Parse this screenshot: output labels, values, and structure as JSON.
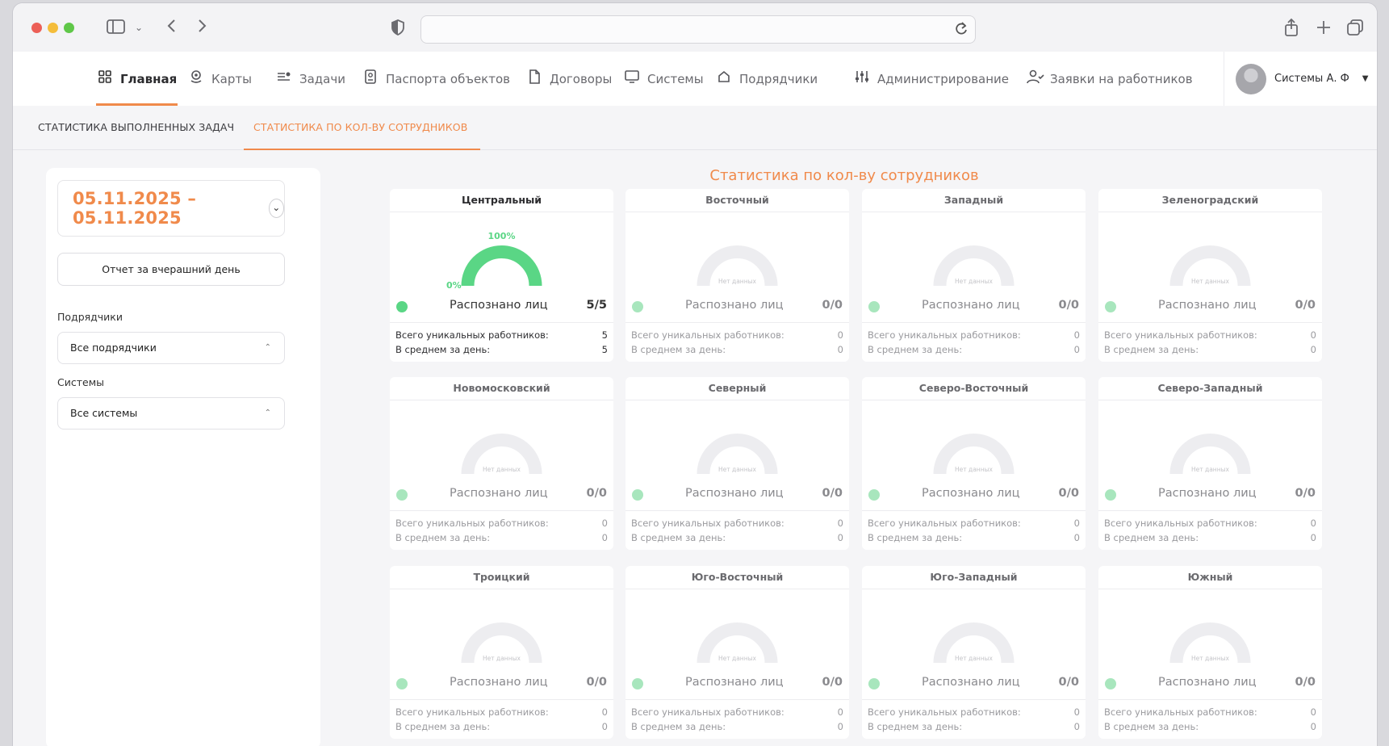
{
  "browser": {
    "controls": [
      "sidebar-toggle-icon",
      "chevron-down-icon",
      "back-icon",
      "forward-icon",
      "shield-icon",
      "reload-icon",
      "share-icon",
      "new-tab-icon",
      "tabs-overview-icon"
    ]
  },
  "nav": {
    "items": [
      {
        "label": "Главная",
        "icon": "grid-icon",
        "active": true
      },
      {
        "label": "Карты",
        "icon": "map-pin-icon"
      },
      {
        "label": "Задачи",
        "icon": "tasks-icon"
      },
      {
        "label": "Паспорта объектов",
        "icon": "passport-icon"
      },
      {
        "label": "Договоры",
        "icon": "document-icon"
      },
      {
        "label": "Системы",
        "icon": "monitor-icon"
      },
      {
        "label": "Подрядчики",
        "icon": "house-icon"
      },
      {
        "label": "Администрирование",
        "icon": "sliders-icon"
      },
      {
        "label": "Заявки на работников",
        "icon": "user-check-icon"
      }
    ],
    "user_name": "Системы А. Ф"
  },
  "tabs": [
    {
      "label": "СТАТИСТИКА ВЫПОЛНЕННЫХ ЗАДАЧ",
      "active": false
    },
    {
      "label": "СТАТИСТИКА ПО КОЛ-ВУ СОТРУДНИКОВ",
      "active": true
    }
  ],
  "sidebar": {
    "date_range": "05.11.2025 – 05.11.2025",
    "report_button": "Отчет за вчерашний день",
    "contractors_label": "Подрядчики",
    "contractors_value": "Все подрядчики",
    "systems_label": "Системы",
    "systems_value": "Все системы"
  },
  "main": {
    "title": "Статистика по кол-ву сотрудников",
    "recog_label": "Распознано лиц",
    "total_label": "Всего уникальных работников:",
    "avg_label": "В среднем за день:",
    "no_data": "Нет данных",
    "gauge_max_label": "100%",
    "gauge_min_label": "0%",
    "colors": {
      "accent": "#f08a4b",
      "gauge": "#5ad685"
    },
    "districts": [
      {
        "name": "Центральный",
        "recognized": "5/5",
        "total": "5",
        "avg": "5",
        "has_data": true,
        "percent": 100
      },
      {
        "name": "Восточный",
        "recognized": "0/0",
        "total": "0",
        "avg": "0",
        "has_data": false
      },
      {
        "name": "Западный",
        "recognized": "0/0",
        "total": "0",
        "avg": "0",
        "has_data": false
      },
      {
        "name": "Зеленоградский",
        "recognized": "0/0",
        "total": "0",
        "avg": "0",
        "has_data": false
      },
      {
        "name": "Новомосковский",
        "recognized": "0/0",
        "total": "0",
        "avg": "0",
        "has_data": false
      },
      {
        "name": "Северный",
        "recognized": "0/0",
        "total": "0",
        "avg": "0",
        "has_data": false
      },
      {
        "name": "Северо-Восточный",
        "recognized": "0/0",
        "total": "0",
        "avg": "0",
        "has_data": false
      },
      {
        "name": "Северо-Западный",
        "recognized": "0/0",
        "total": "0",
        "avg": "0",
        "has_data": false
      },
      {
        "name": "Троицкий",
        "recognized": "0/0",
        "total": "0",
        "avg": "0",
        "has_data": false
      },
      {
        "name": "Юго-Восточный",
        "recognized": "0/0",
        "total": "0",
        "avg": "0",
        "has_data": false
      },
      {
        "name": "Юго-Западный",
        "recognized": "0/0",
        "total": "0",
        "avg": "0",
        "has_data": false
      },
      {
        "name": "Южный",
        "recognized": "0/0",
        "total": "0",
        "avg": "0",
        "has_data": false
      }
    ]
  }
}
